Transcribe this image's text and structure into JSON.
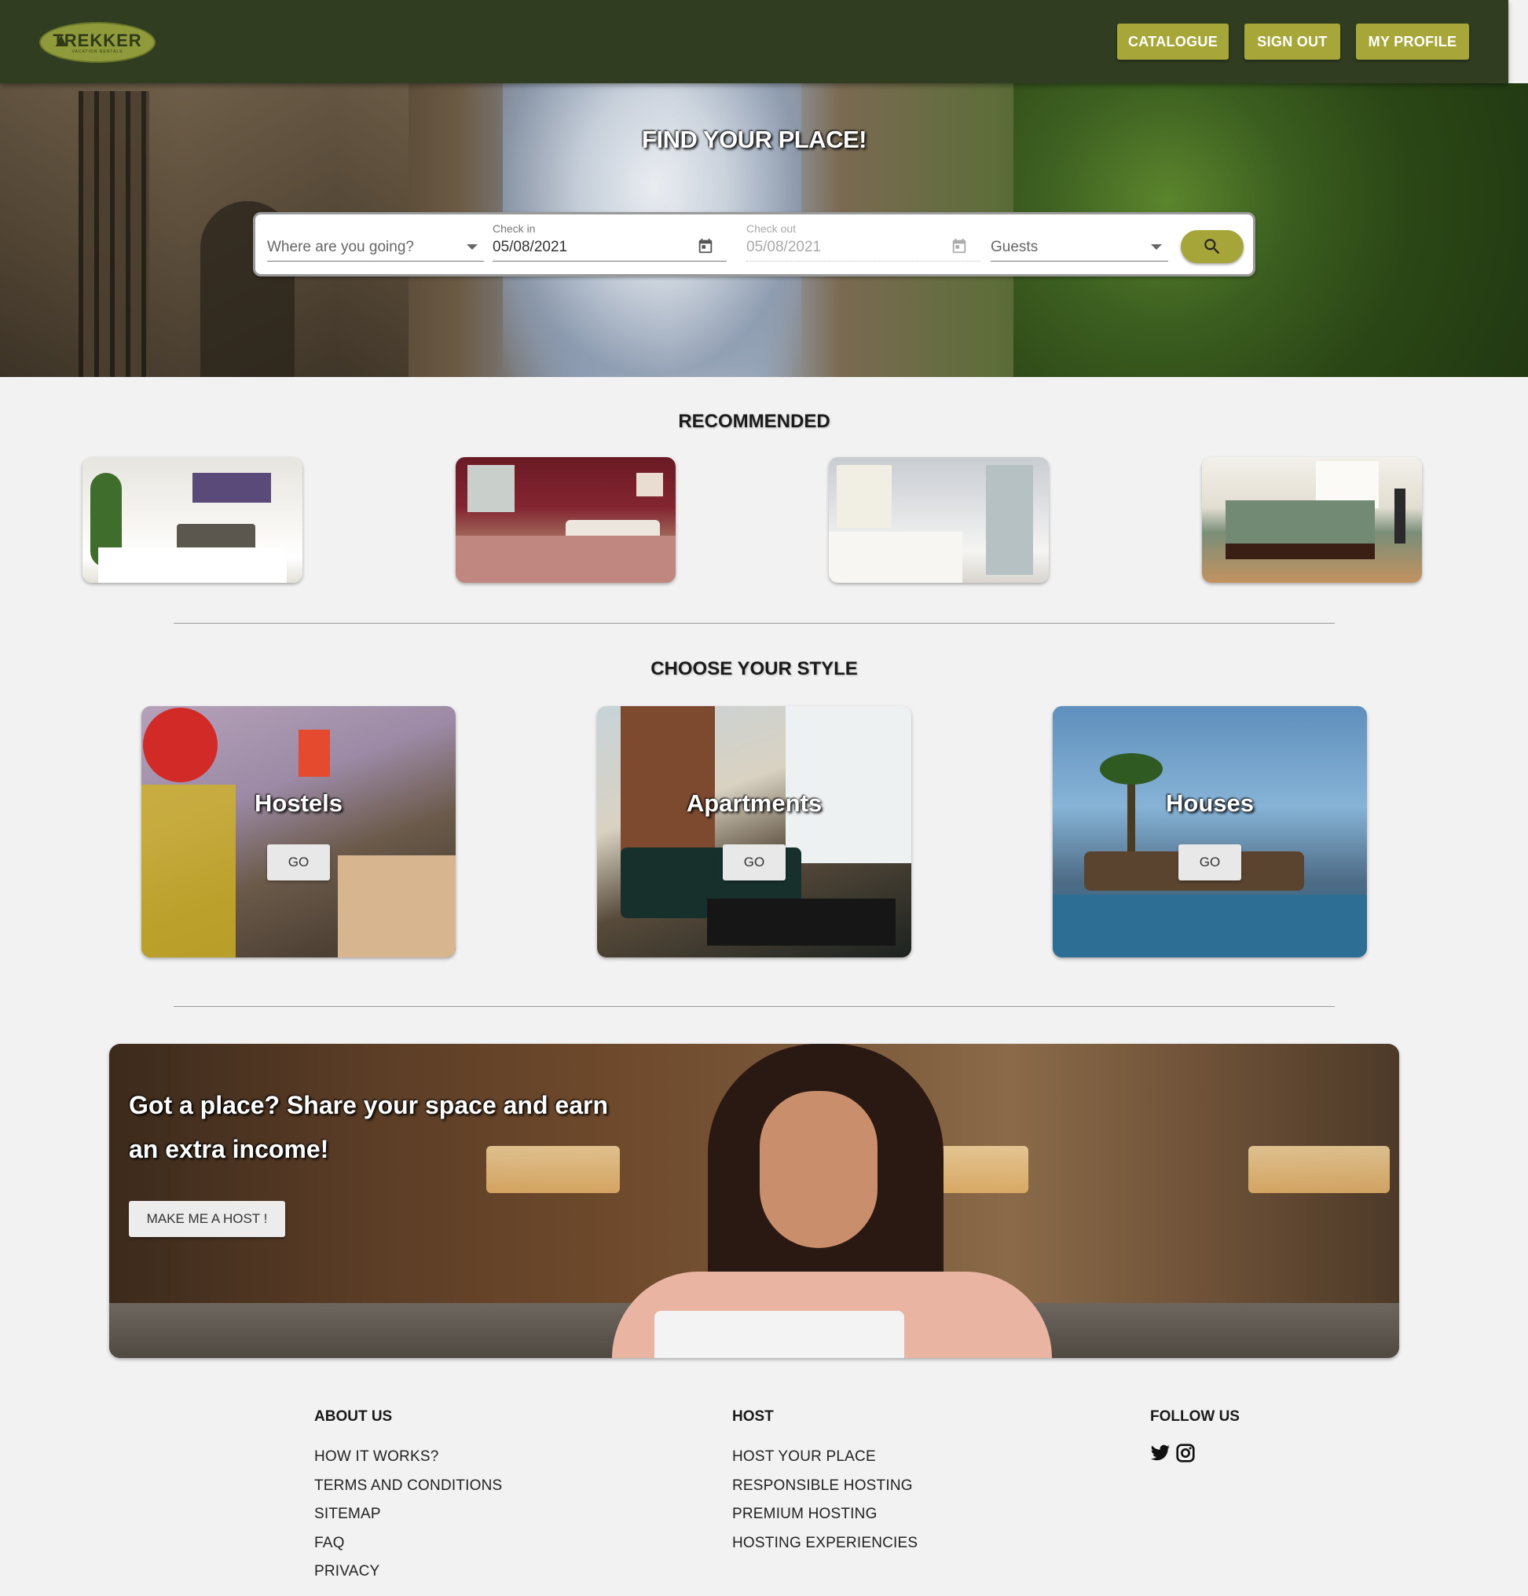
{
  "brand": {
    "logo_text": "TREKKER",
    "logo_sub": "VACATION RENTALS"
  },
  "nav": {
    "catalogue": "CATALOGUE",
    "sign_out": "SIGN OUT",
    "my_profile": "MY PROFILE"
  },
  "hero": {
    "title": "FIND YOUR PLACE!"
  },
  "search": {
    "destination_placeholder": "Where are you going?",
    "checkin_label": "Check in",
    "checkin_value": "05/08/2021",
    "checkout_label": "Check out",
    "checkout_value": "05/08/2021",
    "guests_placeholder": "Guests"
  },
  "recommended": {
    "title": "RECOMMENDED"
  },
  "styles": {
    "title": "CHOOSE YOUR STYLE",
    "cards": [
      {
        "label": "Hostels",
        "button": "GO"
      },
      {
        "label": "Apartments",
        "button": "GO"
      },
      {
        "label": "Houses",
        "button": "GO"
      }
    ]
  },
  "host_banner": {
    "headline": "Got a place? Share your space and earn an extra income!",
    "button": "MAKE ME A HOST !"
  },
  "footer": {
    "about": {
      "title": "ABOUT US",
      "links": [
        "HOW IT WORKS?",
        "TERMS AND CONDITIONS",
        "SITEMAP",
        "FAQ",
        "PRIVACY"
      ]
    },
    "host": {
      "title": "HOST",
      "links": [
        "HOST YOUR PLACE",
        "RESPONSIBLE HOSTING",
        "PREMIUM HOSTING",
        "HOSTING EXPERIENCIES"
      ]
    },
    "follow": {
      "title": "FOLLOW US",
      "icons": [
        "twitter-icon",
        "instagram-icon"
      ]
    }
  },
  "colors": {
    "navbar": "#303d21",
    "accent": "#a7a739",
    "background": "#f2f2f2"
  }
}
